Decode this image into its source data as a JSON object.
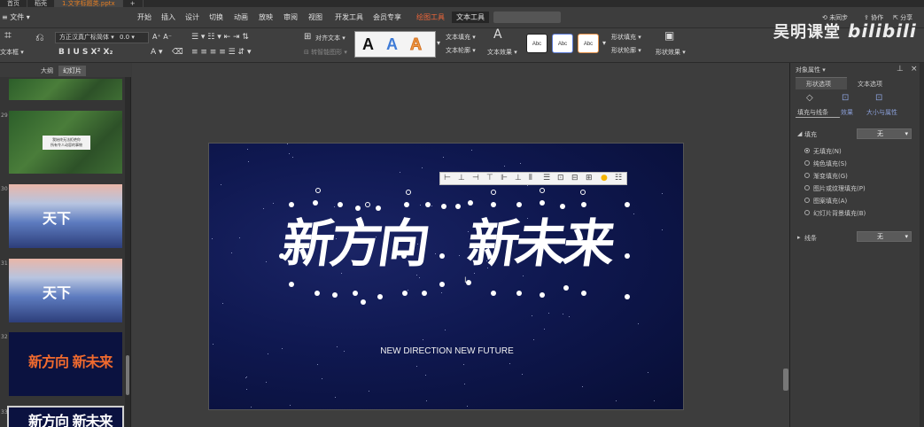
{
  "titlebar": {
    "tabs": [
      {
        "label": "首页",
        "active": false
      },
      {
        "label": "稻壳",
        "active": false
      },
      {
        "label": "1.文字标题类.pptx",
        "active": true
      },
      {
        "label": "+",
        "active": false
      }
    ]
  },
  "menubar": {
    "file": "≡ 文件 ▾",
    "items": [
      "开始",
      "插入",
      "设计",
      "切换",
      "动画",
      "放映",
      "审阅",
      "视图",
      "开发工具",
      "会员专享"
    ],
    "highlight_item": "绘图工具",
    "active_item": "文本工具",
    "right": [
      "⟲ 未同步",
      "⇪ 协作",
      "⇱ 分享"
    ]
  },
  "watermark": {
    "text": "吴明课堂",
    "brand": "bilibili"
  },
  "toolbar": {
    "text_box_label": "文本框 ▾",
    "font_name": "方正汉真广标简体 ▾",
    "font_size": "0.0 ▾",
    "text_fill": "文本填充 ▾",
    "text_outline": "文本轮廓 ▾",
    "text_effect": "文本效果 ▾",
    "align_text": "对齐文本 ▾",
    "shape_fill": "形状填充 ▾",
    "shape_outline": "形状轮廓 ▾",
    "shape_effect": "形状效果 ▾",
    "shape_style_label": "Abc",
    "style_letter": "A"
  },
  "left_panel": {
    "tabs": [
      "大纲",
      "幻灯片"
    ],
    "thumbnails": [
      {
        "number": "",
        "kind": "forest",
        "text": ""
      },
      {
        "number": "29",
        "kind": "forest",
        "text": "我始终无法拒绝你\n所有令人动容的事物"
      },
      {
        "number": "30",
        "kind": "mountain",
        "text": "天下"
      },
      {
        "number": "31",
        "kind": "mountain",
        "text": "天下"
      },
      {
        "number": "32",
        "kind": "dark",
        "text": "新方向 新未来"
      },
      {
        "number": "33",
        "kind": "dark",
        "text": "新方向 新未来"
      }
    ]
  },
  "slide": {
    "title_left": "新方向",
    "title_right": "新未来",
    "subtitle": "NEW DIRECTION NEW FUTURE",
    "float_toolbar_icons": [
      "align-left-icon",
      "align-center-icon",
      "align-right-icon",
      "align-top-icon",
      "align-middle-icon",
      "align-bottom-icon",
      "distribute-h-icon",
      "distribute-v-icon",
      "group-icon",
      "ungroup-icon",
      "more-icon",
      "bulb-icon",
      "list-icon"
    ]
  },
  "right_panel": {
    "title": "对象属性 ▾",
    "tabs": [
      "形状选项",
      "文本选项"
    ],
    "subtabs": [
      "填充与线条",
      "效果",
      "大小与属性"
    ],
    "fill_label": "填充",
    "fill_value": "无",
    "fill_options": [
      "无填充(N)",
      "纯色填充(S)",
      "渐变填充(G)",
      "图片或纹理填充(P)",
      "图案填充(A)",
      "幻灯片背景填充(B)"
    ],
    "line_label": "线条",
    "line_value": "无"
  }
}
